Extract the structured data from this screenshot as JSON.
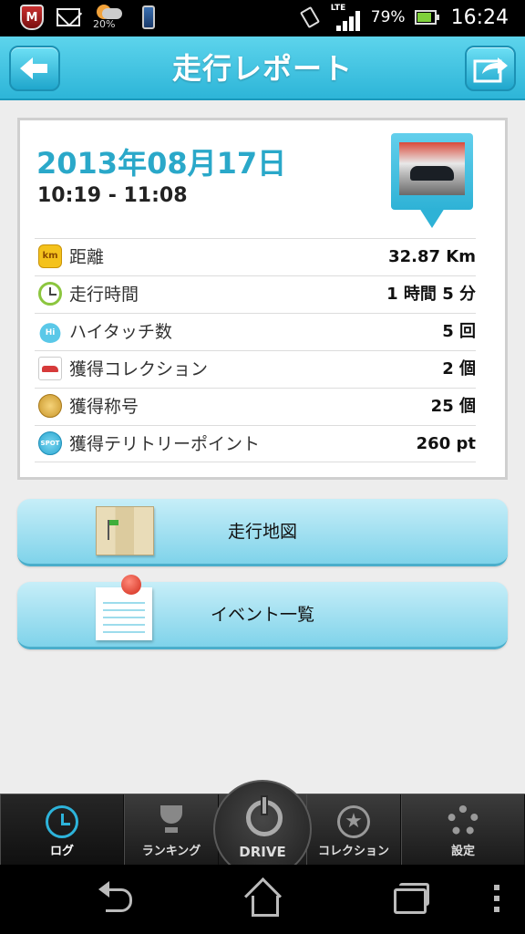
{
  "status_bar": {
    "weather_pct": "20%",
    "network": "LTE",
    "battery_pct": "79%",
    "time": "16:24"
  },
  "header": {
    "title": "走行レポート",
    "back_icon": "arrow-left-icon",
    "share_icon": "share-icon"
  },
  "report": {
    "date": "2013年08月17日",
    "time_range": "10:19 - 11:08",
    "stats": [
      {
        "icon": "km-icon",
        "badge": "km",
        "label": "距離",
        "value": "32.87 Km"
      },
      {
        "icon": "clock-icon",
        "badge": "",
        "label": "走行時間",
        "value": "1 時間 5 分"
      },
      {
        "icon": "hi-touch-icon",
        "badge": "Hi",
        "label": "ハイタッチ数",
        "value": "5 回"
      },
      {
        "icon": "car-icon",
        "badge": "",
        "label": "獲得コレクション",
        "value": "2 個"
      },
      {
        "icon": "medal-icon",
        "badge": "",
        "label": "獲得称号",
        "value": "25 個"
      },
      {
        "icon": "spot-icon",
        "badge": "SPOT",
        "label": "獲得テリトリーポイント",
        "value": "260 pt"
      }
    ]
  },
  "actions": {
    "map_label": "走行地図",
    "event_label": "イベント一覧"
  },
  "tabs": {
    "log": "ログ",
    "ranking": "ランキング",
    "drive": "DRIVE",
    "collection": "コレクション",
    "settings": "設定"
  },
  "colors": {
    "accent": "#2aa8c9",
    "header": "#3cc1e0",
    "action_button": "#a8e2f2"
  }
}
